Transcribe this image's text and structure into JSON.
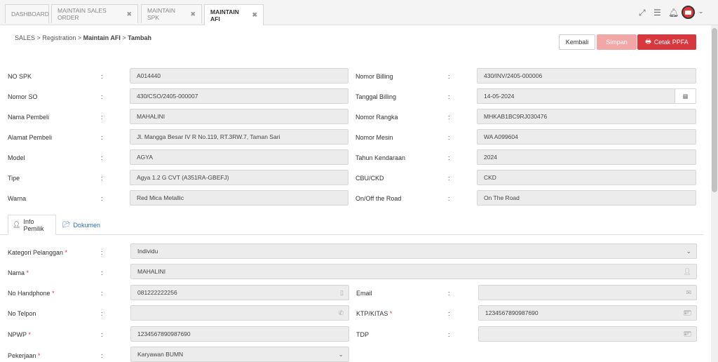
{
  "tabs": [
    {
      "label": "DASHBOARD",
      "closable": false
    },
    {
      "label": "MAINTAIN SALES ORDER",
      "closable": true
    },
    {
      "label": "MAINTAIN SPK",
      "closable": true
    },
    {
      "label": "MAINTAIN AFI",
      "closable": true
    }
  ],
  "breadcrumb": {
    "l1": "SALES",
    "l2": "Registration",
    "l3": "Maintain AFI",
    "l4": "Tambah",
    "sep": ">"
  },
  "buttons": {
    "kembali": "Kembali",
    "simpan": "Simpan",
    "cetak": "Cetak PPFA"
  },
  "colon": ":",
  "left_fields": [
    {
      "label": "NO SPK",
      "value": "A014440"
    },
    {
      "label": "Nomor SO",
      "value": "430/CSO/2405-000007"
    },
    {
      "label": "Nama Pembeli",
      "value": "MAHALINI"
    },
    {
      "label": "Alamat Pembeli",
      "value": "Jl. Mangga Besar IV R No.119, RT.3RW.7, Taman Sari"
    },
    {
      "label": "Model",
      "value": "AGYA"
    },
    {
      "label": "Tipe",
      "value": "Agya 1.2 G CVT (A351RA-GBEFJ)"
    },
    {
      "label": "Warna",
      "value": "Red Mica Metallic"
    }
  ],
  "right_fields": [
    {
      "label": "Nomor Billing",
      "value": "430/INV/2405-000006"
    },
    {
      "label": "Tanggal Billing",
      "value": "14-05-2024"
    },
    {
      "label": "Nomor Rangka",
      "value": "MHKAB1BC9RJ030476"
    },
    {
      "label": "Nomor Mesin",
      "value": "WA A099604"
    },
    {
      "label": "Tahun Kendaraan",
      "value": "2024"
    },
    {
      "label": "CBU/CKD",
      "value": "CKD"
    },
    {
      "label": "On/Off the Road",
      "value": "On The Road"
    }
  ],
  "subtabs": {
    "info": "Info Pemilik",
    "dokumen": "Dokumen"
  },
  "owner": {
    "kategori": {
      "label": "Kategori Pelanggan",
      "value": "Individu"
    },
    "nama": {
      "label": "Nama",
      "value": "MAHALINI"
    },
    "handphone": {
      "label": "No Handphone",
      "value": "081222222256"
    },
    "email": {
      "label": "Email",
      "value": ""
    },
    "telpon": {
      "label": "No Telpon",
      "value": ""
    },
    "ktp": {
      "label": "KTP/KITAS",
      "value": "1234567890987690"
    },
    "npwp": {
      "label": "NPWP",
      "value": "1234567890987690"
    },
    "tdp": {
      "label": "TDP",
      "value": ""
    },
    "pekerjaan": {
      "label": "Pekerjaan",
      "value": "Karyawan BUMN"
    }
  },
  "required_mark": "*",
  "colors": {
    "danger": "#d9363e",
    "danger_light": "#f3a6a6",
    "link": "#2a6fb5"
  },
  "icons": [
    "expand-icon",
    "menu-icon",
    "bell-icon",
    "avatar",
    "calendar-icon",
    "user-icon",
    "mobile-icon",
    "envelope-icon",
    "phone-icon",
    "id-card-icon",
    "printer-icon",
    "folder-icon"
  ]
}
